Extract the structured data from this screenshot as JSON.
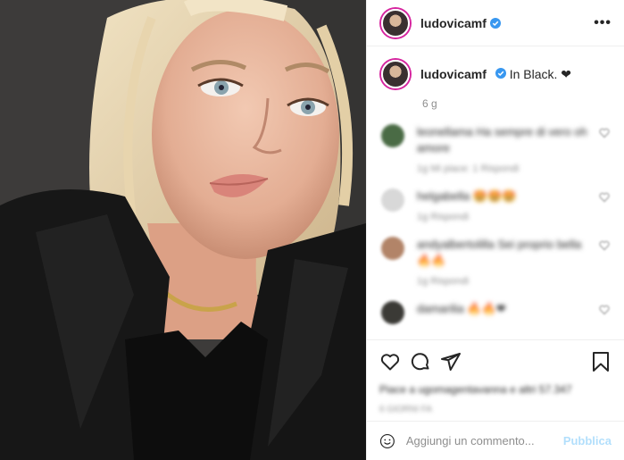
{
  "post": {
    "username": "ludovicamf",
    "caption": "In Black. ❤",
    "time_ago": "6 g"
  },
  "header": {
    "username": "ludovicamf",
    "more_icon": "•••"
  },
  "comments": [
    {
      "text": "leonellama Ha sempre di vero oh amore",
      "meta": "1g  Mi piace: 1  Rispondi",
      "avatar_color": "#4a6b45"
    },
    {
      "text": "helgabella 🤩🤩🤩",
      "meta": "1g  Rispondi",
      "avatar_color": "#d8d8d8"
    },
    {
      "text": "andyalbertolilla Sei proprio bella 🔥🔥",
      "meta": "1g  Rispondi",
      "avatar_color": "#b28468"
    },
    {
      "text": "damarilia 🔥🔥❤",
      "meta": "",
      "avatar_color": "#3b3a36"
    }
  ],
  "actions": {
    "likes_text": "Piace a ugomagentavanna e altri 57.347",
    "likes_time": "6 GIORNI FA"
  },
  "add_comment": {
    "placeholder": "Aggiungi un commento...",
    "publish": "Pubblica"
  },
  "colors": {
    "verified": "#3897f0",
    "story_ring": "#d6249f",
    "publish": "#b2dffc"
  }
}
